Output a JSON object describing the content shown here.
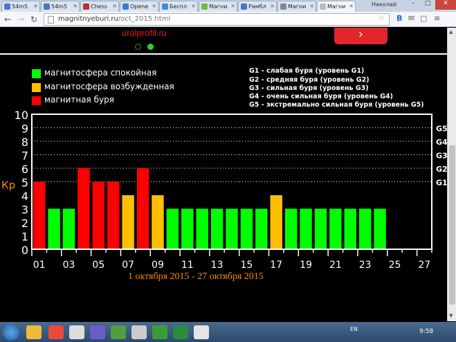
{
  "browser": {
    "tabs": [
      {
        "label": "54m5",
        "color": "#4a76c6"
      },
      {
        "label": "54m5",
        "color": "#4a76c6"
      },
      {
        "label": "Chess",
        "color": "#b3322c"
      },
      {
        "label": "Opene",
        "color": "#3c7bd6"
      },
      {
        "label": "Беспл",
        "color": "#3f8ae0"
      },
      {
        "label": "Магни",
        "color": "#7ab648"
      },
      {
        "label": "Рамбл",
        "color": "#5570c5"
      },
      {
        "label": "Магни",
        "color": "#888888"
      },
      {
        "label": "Магни",
        "color": "#bbbbbb"
      }
    ],
    "user": "Николай",
    "url_domain": "magnitnyeburi.ru",
    "url_path": "/oct_2015.html"
  },
  "site": {
    "name": "uralprofil.ru",
    "banner_glyph": "›"
  },
  "legend": {
    "items": [
      {
        "label": "магнитосфера спокойная",
        "color": "#00ff00"
      },
      {
        "label": "магнитосфера возбужденная",
        "color": "#ffbf00"
      },
      {
        "label": "магнитная буря",
        "color": "#ff0000"
      }
    ],
    "storm_levels": [
      "G1 - слабая буря (уровень G1)",
      "G2 - средняя буря (уровень G2)",
      "G3 - сильная буря (уровень G3)",
      "G4 - очень сильная буря (уровень G4)",
      "G5 - экстремально сильная буря (уровень G5)"
    ]
  },
  "chart_data": {
    "type": "bar",
    "ylabel": "Кp",
    "ylim": [
      0,
      10
    ],
    "yticks": [
      "0",
      "1",
      "2",
      "3",
      "4",
      "5",
      "6",
      "7",
      "8",
      "9",
      "10"
    ],
    "right_labels": [
      {
        "label": "G1",
        "y": 5
      },
      {
        "label": "G2",
        "y": 6
      },
      {
        "label": "G3",
        "y": 7
      },
      {
        "label": "G4",
        "y": 8
      },
      {
        "label": "G5",
        "y": 9
      }
    ],
    "x_tick_labels": [
      "01",
      "03",
      "05",
      "07",
      "09",
      "11",
      "13",
      "15",
      "17",
      "19",
      "21",
      "23",
      "25",
      "27"
    ],
    "days": 27,
    "values": [
      5,
      3,
      3,
      6,
      5,
      5,
      4,
      6,
      4,
      3,
      3,
      3,
      3,
      3,
      3,
      3,
      4,
      3,
      3,
      3,
      3,
      3,
      3,
      3
    ],
    "colors": {
      "calm": "#00ff00",
      "excited": "#ffbf00",
      "storm": "#ff0000"
    },
    "grid": "dotted white at G levels",
    "xlabel": "1 октября 2015 - 27 октября 2015"
  },
  "taskbar": {
    "lang": "EN",
    "time": "9:58"
  }
}
